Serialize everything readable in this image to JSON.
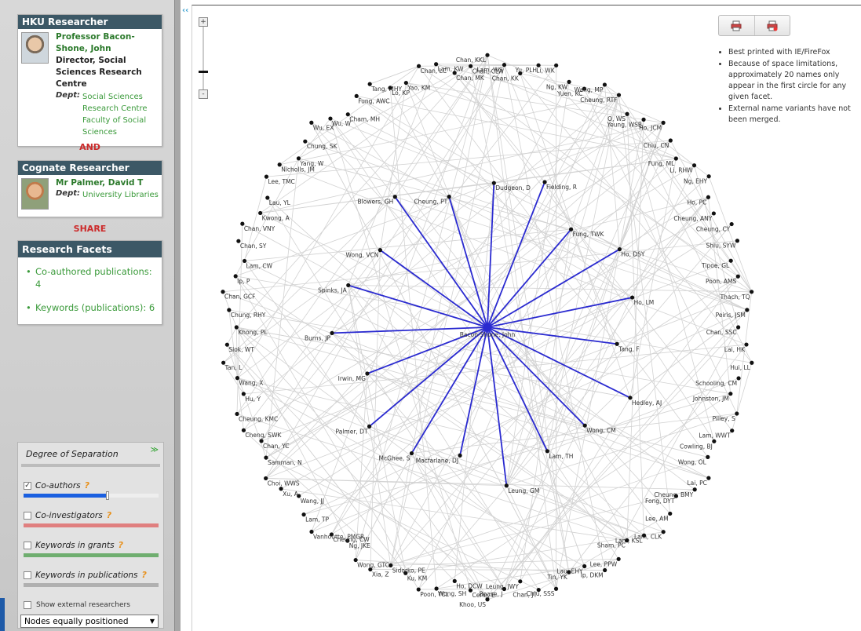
{
  "researcher": {
    "header": "HKU Researcher",
    "name": "Professor Bacon-Shone, John",
    "title": "Director, Social Sciences Research Centre",
    "dept_label": "Dept:",
    "depts": [
      "Social Sciences",
      "Research Centre",
      "Faculty of Social",
      "Sciences"
    ]
  },
  "and_label": "AND",
  "cognate": {
    "header": "Cognate Researcher",
    "name": "Mr Palmer, David T",
    "dept_label": "Dept:",
    "dept": "University Libraries"
  },
  "share_label": "SHARE",
  "facets": {
    "header": "Research Facets",
    "items": [
      "Co-authored publications: 4",
      "Keywords (publications): 6"
    ]
  },
  "dos": {
    "title": "Degree of Separation",
    "rows": [
      {
        "label": "Co-authors",
        "checked": true,
        "color": "#1a5fe0",
        "level": 0.62
      },
      {
        "label": "Co-investigators",
        "checked": false,
        "color": "#e07f7f",
        "level": 1.0
      },
      {
        "label": "Keywords in grants",
        "checked": false,
        "color": "#6fae6f",
        "level": 1.0
      },
      {
        "label": "Keywords in publications",
        "checked": false,
        "color": "#b0b0b0",
        "level": 1.0
      }
    ],
    "help_mark": "?",
    "ext_label": "Show external researchers",
    "layout_select": "Nodes equally positioned"
  },
  "zoom": {
    "plus": "+",
    "minus": "-"
  },
  "collapse_icon": "‹‹",
  "notes": [
    "Best printed with IE/FireFox",
    "Because of space limitations, approximately 20 names only appear in the first circle for any given facet.",
    "External name variants have not been merged."
  ],
  "graph": {
    "center": "Bacon-Shone, John",
    "edge_color": "#2a2ad0",
    "inner": [
      "Dudgeon, D",
      "Fielding, R",
      "Fung, TWK",
      "Ho, DSY",
      "Ho, LM",
      "Tang, F",
      "Hedley, AJ",
      "Wong, CM",
      "Lam, TH",
      "Leung, GM",
      "Macfarlane, DJ",
      "McGhee, S",
      "Palmer, DT",
      "Irwin, MG",
      "Burns, JP",
      "Spinks, JA",
      "Wong, VCN",
      "Blowers, GH",
      "Cheung, PT"
    ],
    "outer": [
      "Chan, KKL",
      "Lam, WS",
      "Chan, KK",
      "Yu, PLH",
      "Li, WK",
      "Ng, KW",
      "Yuen, KC",
      "Wang, MP",
      "Cheung, RTF",
      "O, WS",
      "Yeung, WSB",
      "Ho, JCM",
      "Chiu, CN",
      "Fung, ML",
      "Li, RHW",
      "Ng, EHY",
      "Ho, PC",
      "Cheung, ANY",
      "Cheung, CY",
      "Shiu, SYW",
      "Tipoe, GL",
      "Poon, AMS",
      "Thach, TQ",
      "Peiris, JSM",
      "Chan, SSC",
      "Lai, HK",
      "Hui, LL",
      "Schooling, CM",
      "Johnston, JM",
      "Pilley, S",
      "Lam, WWT",
      "Cowling, BJ",
      "Wong, OL",
      "Lai, PC",
      "Cheung, BMY",
      "Fong, DYT",
      "Lee, AM",
      "Lam, CLK",
      "Lam, KSL",
      "Sham, PC",
      "Lee, PPW",
      "Ip, DKM",
      "Lau, EHY",
      "Tin, YK",
      "Chiu, SSS",
      "Chan, JT",
      "Leung, JWY",
      "Boase, J",
      "Khoo, US",
      "Cerin, E",
      "Ho, DCW",
      "Wong, SH",
      "Poon, TCL",
      "Ku, KM",
      "Sidorko, PE",
      "Xia, Z",
      "Wong, GTC",
      "Ng, JKE",
      "Cheung, CW",
      "Vanhoutte, PMGR",
      "Lam, TP",
      "Wang, JJ",
      "Xu, A",
      "Choi, WWS",
      "Samman, N",
      "Chan, YC",
      "Cheng, SWK",
      "Cheung, KMC",
      "Hu, Y",
      "Wang, X",
      "Tan, L",
      "Siok, WT",
      "Khong, PL",
      "Chung, RHY",
      "Chan, GCF",
      "Ip, P",
      "Lam, CW",
      "Chan, SY",
      "Chan, VNY",
      "Kwong, A",
      "Lau, YL",
      "Lee, TMC",
      "Nicholls, JM",
      "Yang, W",
      "Chung, SK",
      "Wu, EX",
      "Wu, W",
      "Cham, MH",
      "Fung, AWC",
      "Tang, MHY",
      "Lo, KP",
      "Yao, KM",
      "Chan, LC",
      "Lam, KW",
      "Chan, MK",
      "Chan, CLW"
    ]
  }
}
